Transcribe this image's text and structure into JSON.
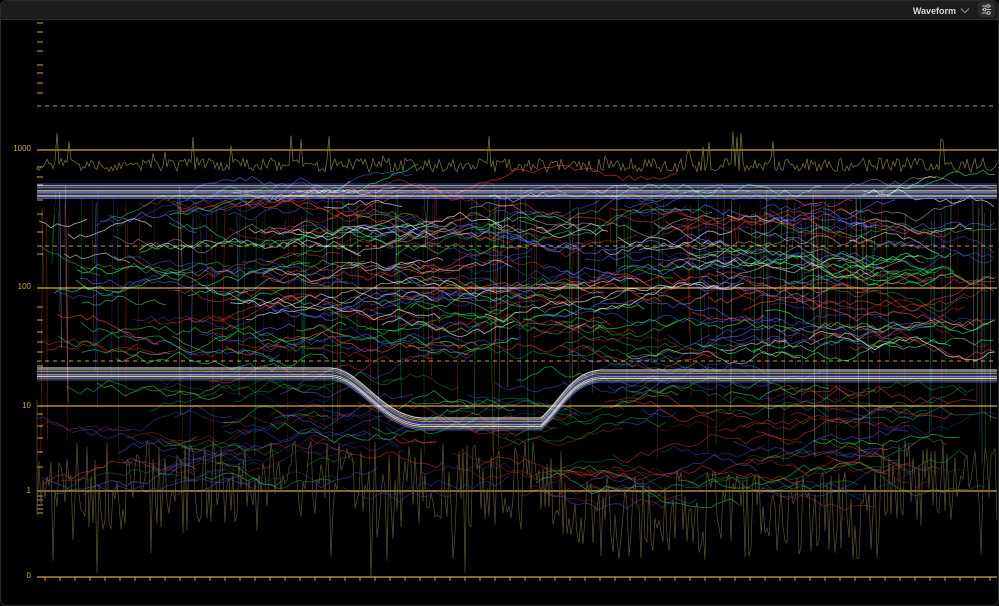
{
  "toolbar": {
    "scope_type": "Waveform",
    "settings_icon": "sliders-icon"
  },
  "scope": {
    "mode": "waveform",
    "y_scale": "log",
    "y_tick_labels": [
      "1000",
      "100",
      "10",
      "1",
      "0"
    ],
    "guide_color": "#d0a248",
    "dashed_guide_color": "#c99a42",
    "trace_colors": {
      "red": "#ff4a3a",
      "green": "#3cff6a",
      "blue": "#5a6aff",
      "white": "#f4f4f6"
    }
  }
}
